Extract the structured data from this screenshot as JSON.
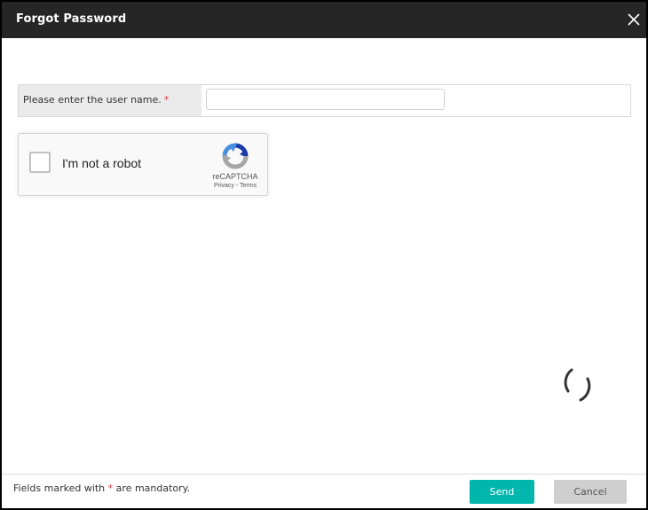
{
  "dialog": {
    "title": "Forgot Password",
    "close_icon": "close-icon"
  },
  "form": {
    "username_label": "Please enter the user name.",
    "required_marker": "*",
    "username_value": "",
    "username_placeholder": ""
  },
  "recaptcha": {
    "label": "I'm not a robot",
    "brand": "reCAPTCHA",
    "privacy": "Privacy",
    "separator": " - ",
    "terms": "Terms",
    "checked": false,
    "logo_icon": "recaptcha-logo-icon"
  },
  "loading": {
    "icon": "loading-spinner-icon"
  },
  "footer": {
    "note_prefix": "Fields marked with ",
    "note_marker": "*",
    "note_suffix": " are mandatory.",
    "send_label": "Send",
    "cancel_label": "Cancel"
  },
  "colors": {
    "titlebar_bg": "#262626",
    "accent": "#00b6ad",
    "required": "#e03b3b",
    "cancel_bg": "#cfcfcf"
  }
}
